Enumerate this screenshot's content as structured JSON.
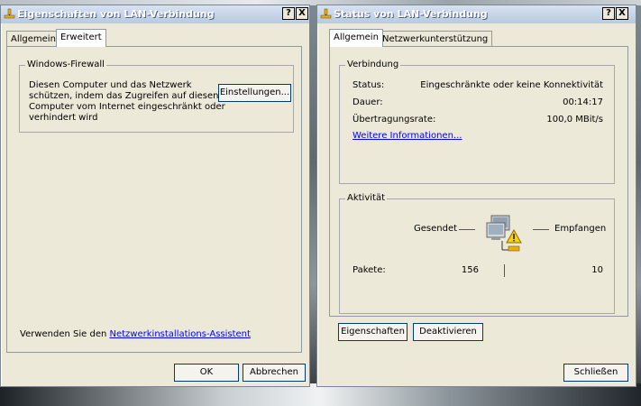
{
  "left_window": {
    "title": "Eigenschaften von LAN-Verbindung",
    "help_btn": "?",
    "close_btn": "X",
    "tabs": [
      "Allgemein",
      "Erweitert"
    ],
    "firewall": {
      "legend": "Windows-Firewall",
      "text_lines": [
        "Diesen Computer und das Netzwerk",
        "schützen, indem das Zugreifen auf diesen",
        "Computer vom Internet eingeschränkt oder",
        "verhindert wird"
      ],
      "settings_btn": "Einstellungen..."
    },
    "assistant_prefix": "Verwenden Sie den ",
    "assistant_link": "Netzwerkinstallations-Assistent",
    "ok_btn": "OK",
    "cancel_btn": "Abbrechen"
  },
  "right_window": {
    "title": "Status von LAN-Verbindung",
    "help_btn": "?",
    "close_btn": "X",
    "tabs": [
      "Allgemein",
      "Netzwerkunterstützung"
    ],
    "connection": {
      "legend": "Verbindung",
      "status_label": "Status:",
      "status_value": "Eingeschränkte oder keine Konnektivität",
      "duration_label": "Dauer:",
      "duration_value": "00:14:17",
      "rate_label": "Übertragungsrate:",
      "rate_value": "100,0 MBit/s",
      "more_info": "Weitere Informationen..."
    },
    "activity": {
      "legend": "Aktivität",
      "sent_label": "Gesendet",
      "received_label": "Empfangen",
      "packets_label": "Pakete:",
      "sent_value": "156",
      "received_value": "10"
    },
    "properties_btn": "Eigenschaften",
    "disable_btn": "Deaktivieren",
    "close_button": "Schließen"
  }
}
